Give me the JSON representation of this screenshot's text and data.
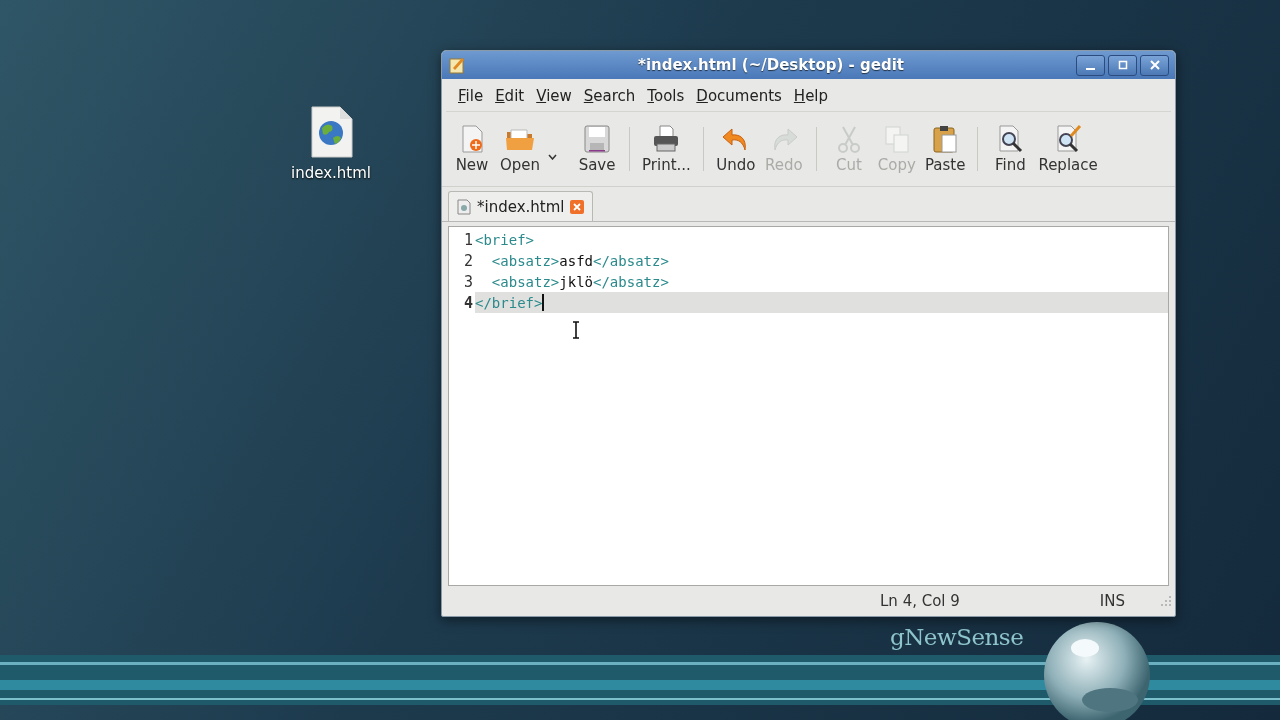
{
  "desktop": {
    "icons": [
      {
        "label": "index.html"
      }
    ],
    "wallpaper": {
      "logo": "gNewSense"
    }
  },
  "window": {
    "title": "*index.html (~/Desktop) - gedit",
    "active": true
  },
  "menu": [
    {
      "label": "File"
    },
    {
      "label": "Edit"
    },
    {
      "label": "View"
    },
    {
      "label": "Search"
    },
    {
      "label": "Tools"
    },
    {
      "label": "Documents"
    },
    {
      "label": "Help"
    }
  ],
  "toolbar": [
    {
      "kind": "button",
      "label": "New",
      "disabled": false
    },
    {
      "kind": "button",
      "label": "Open",
      "disabled": false
    },
    {
      "kind": "dropdown"
    },
    {
      "kind": "button",
      "label": "Save",
      "disabled": false
    },
    {
      "kind": "separator"
    },
    {
      "kind": "button",
      "label": "Print...",
      "disabled": false
    },
    {
      "kind": "separator"
    },
    {
      "kind": "button",
      "label": "Undo",
      "disabled": false
    },
    {
      "kind": "button",
      "label": "Redo",
      "disabled": true
    },
    {
      "kind": "separator"
    },
    {
      "kind": "button",
      "label": "Cut",
      "disabled": true
    },
    {
      "kind": "button",
      "label": "Copy",
      "disabled": true
    },
    {
      "kind": "button",
      "label": "Paste",
      "disabled": false
    },
    {
      "kind": "separator"
    },
    {
      "kind": "button",
      "label": "Find",
      "disabled": false
    },
    {
      "kind": "button",
      "label": "Replace",
      "disabled": false
    }
  ],
  "tabs": [
    {
      "label": "*index.html",
      "selected": true
    }
  ],
  "editor": {
    "lines": [
      {
        "number": "1",
        "current": false,
        "tokens": [
          {
            "kind": "tag",
            "text": "<brief>"
          }
        ]
      },
      {
        "number": "2",
        "current": false,
        "tokens": [
          {
            "kind": "tag",
            "text": "  <absatz>"
          },
          {
            "kind": "text",
            "text": "asfd"
          },
          {
            "kind": "tag",
            "text": "</absatz>"
          }
        ]
      },
      {
        "number": "3",
        "current": false,
        "tokens": [
          {
            "kind": "tag",
            "text": "  <absatz>"
          },
          {
            "kind": "text",
            "text": "jklö"
          },
          {
            "kind": "tag",
            "text": "</absatz>"
          }
        ]
      },
      {
        "number": "4",
        "current": true,
        "tokens": [
          {
            "kind": "tag",
            "text": "</brief>"
          }
        ]
      }
    ]
  },
  "status_bar": {
    "position": "Ln 4, Col 9",
    "mode": "INS"
  }
}
